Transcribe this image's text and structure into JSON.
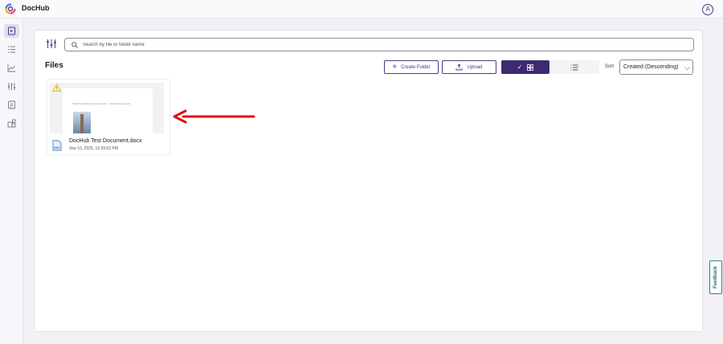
{
  "app": {
    "brand": "DocHub",
    "avatar_initial": "A",
    "colors": {
      "accent": "#3d2a72",
      "accent_border": "#4b3a86",
      "feedback": "#2a8a7d",
      "annotation_arrow": "#e01010"
    }
  },
  "sidebar": {
    "items": [
      {
        "icon": "documents-icon",
        "active": true
      },
      {
        "icon": "checklist-icon",
        "active": false
      },
      {
        "icon": "chart-icon",
        "active": false
      },
      {
        "icon": "sliders-icon",
        "active": false
      },
      {
        "icon": "template-icon",
        "active": false
      },
      {
        "icon": "integrations-icon",
        "active": false
      }
    ]
  },
  "search": {
    "placeholder": "Search by file or folder name",
    "value": ""
  },
  "files": {
    "title": "Files",
    "create_folder_label": "Create Folder",
    "upload_label": "Upload",
    "sort_label": "Sort",
    "sort_value": "Created (Descending)",
    "items": [
      {
        "name": "DocHub Test Document.docx",
        "date": "Sep 10, 2025, 12:59:52 PM",
        "thumbnail_text": "Total Presentable Test Document - Shelter Documents",
        "file_type_icon": "doc-file-icon",
        "warning": true
      }
    ]
  },
  "feedback_label": "Feedback"
}
